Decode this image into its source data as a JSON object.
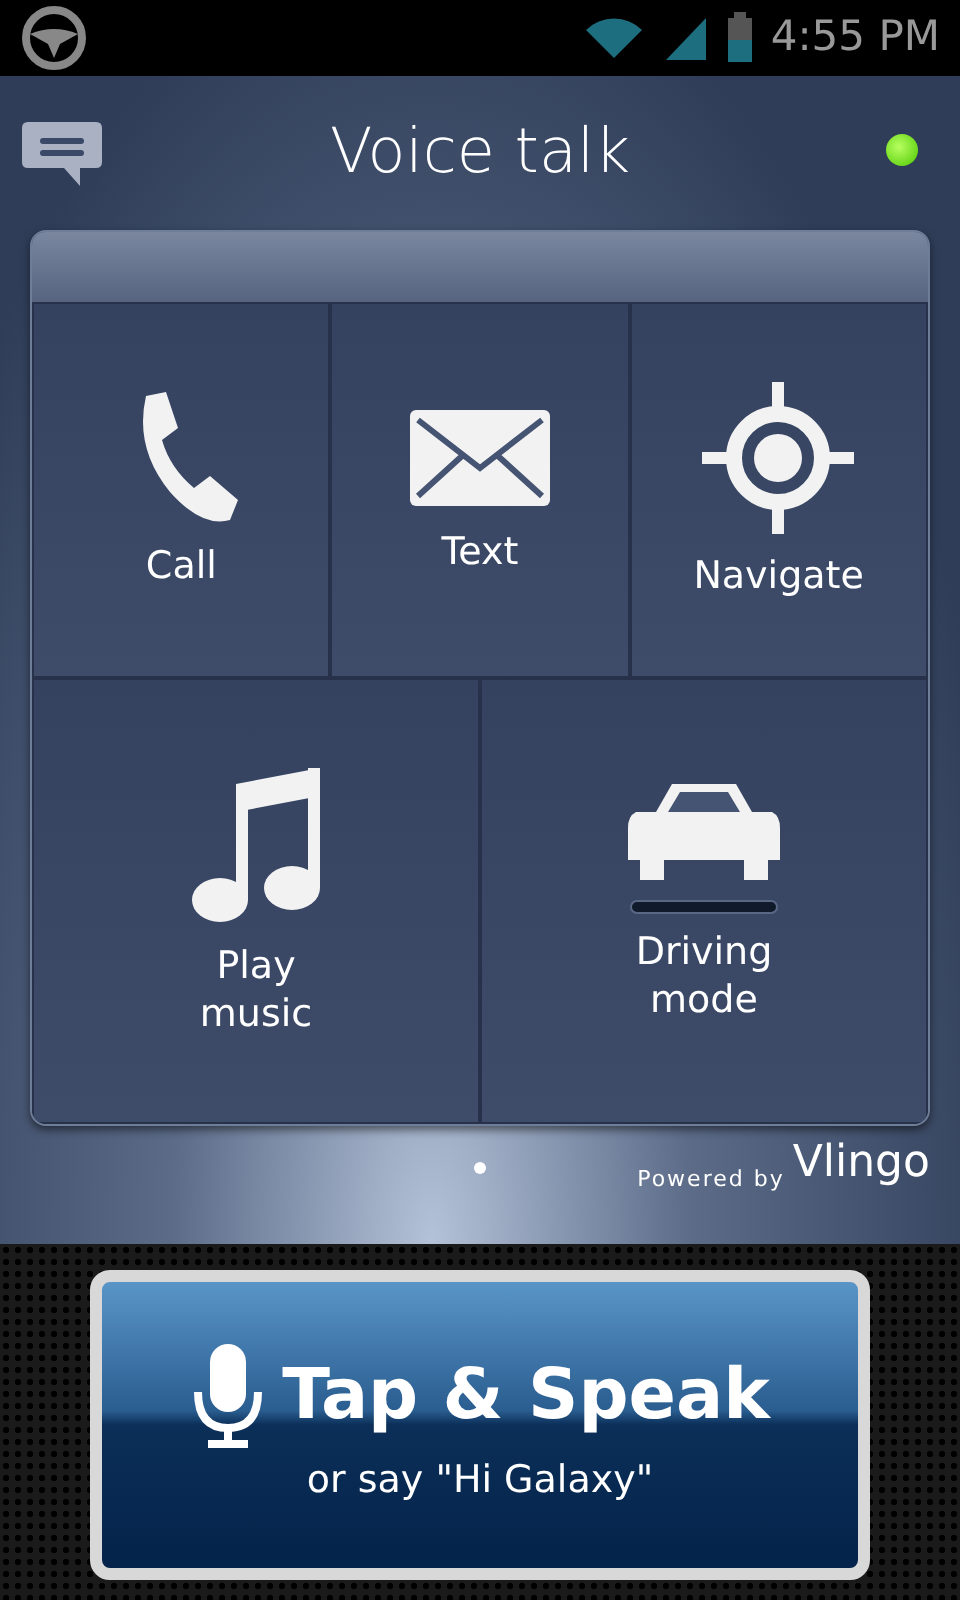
{
  "status_bar": {
    "time": "4:55 PM"
  },
  "header": {
    "title": "Voice talk",
    "connected": true
  },
  "commands": [
    {
      "kind": "call",
      "label": "Call"
    },
    {
      "kind": "text",
      "label": "Text"
    },
    {
      "kind": "navigate",
      "label": "Navigate"
    },
    {
      "kind": "music",
      "label": "Play music"
    },
    {
      "kind": "driving",
      "label": "Driving mode",
      "on": false
    }
  ],
  "pages": [
    {
      "selected": true
    }
  ],
  "powered_by": {
    "label": "Powered by",
    "brand": "Vlingo"
  },
  "speak_button": {
    "label": "Tap & Speak",
    "hint": "or say \"Hi Galaxy\""
  }
}
